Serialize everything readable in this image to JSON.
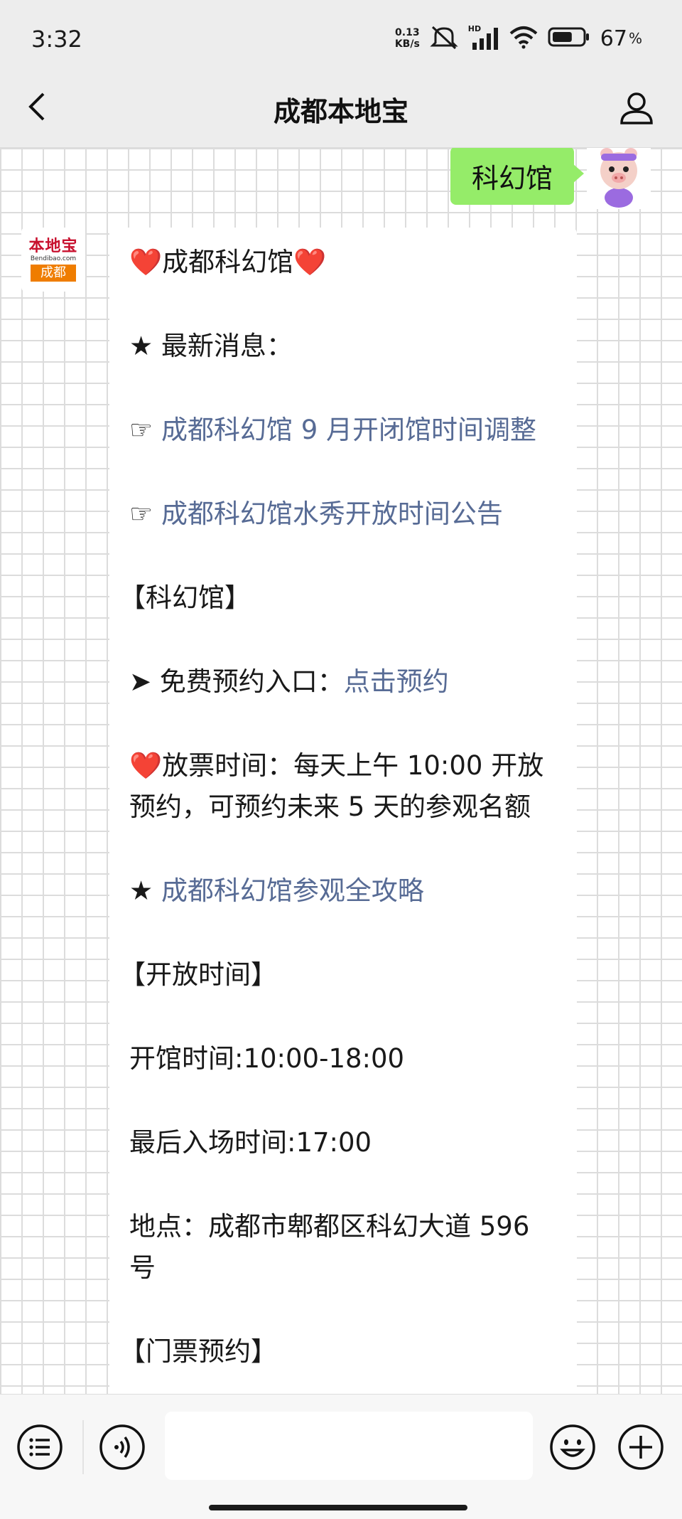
{
  "status_bar": {
    "time": "3:32",
    "net_speed_value": "0.13",
    "net_speed_unit": "KB/s",
    "network_label": "HD",
    "battery_percent": "67",
    "battery_symbol": "%",
    "battery_level": 0.67
  },
  "header": {
    "title": "成都本地宝"
  },
  "chat": {
    "user_message": "科幻馆",
    "bot_logo": {
      "name": "本地宝",
      "domain": "Bendibao.com",
      "city": "成都"
    },
    "bot_lines": [
      {
        "prefix": "❤️",
        "text": "成都科幻馆",
        "suffix": "❤️"
      },
      {
        "prefix": "★ ",
        "text": "最新消息："
      },
      {
        "prefix": "☞ ",
        "link": "成都科幻馆 9 月开闭馆时间调整"
      },
      {
        "prefix": "☞  ",
        "link": "成都科幻馆水秀开放时间公告"
      },
      {
        "text": "【科幻馆】"
      },
      {
        "prefix": "➤ ",
        "text": "免费预约入口：",
        "link": "点击预约"
      },
      {
        "prefix": "❤️",
        "text": "放票时间：每天上午 10:00 开放预约，可预约未来 5 天的参观名额"
      },
      {
        "prefix": "★ ",
        "link": "成都科幻馆参观全攻略"
      },
      {
        "text": "【开放时间】"
      },
      {
        "text": "开馆时间:10:00-18:00"
      },
      {
        "text": "最后入场时间:17:00"
      },
      {
        "text": "地点：成都市郫都区科幻大道 596 号"
      },
      {
        "text": "【门票预约】"
      }
    ]
  },
  "input_bar": {
    "placeholder": ""
  }
}
